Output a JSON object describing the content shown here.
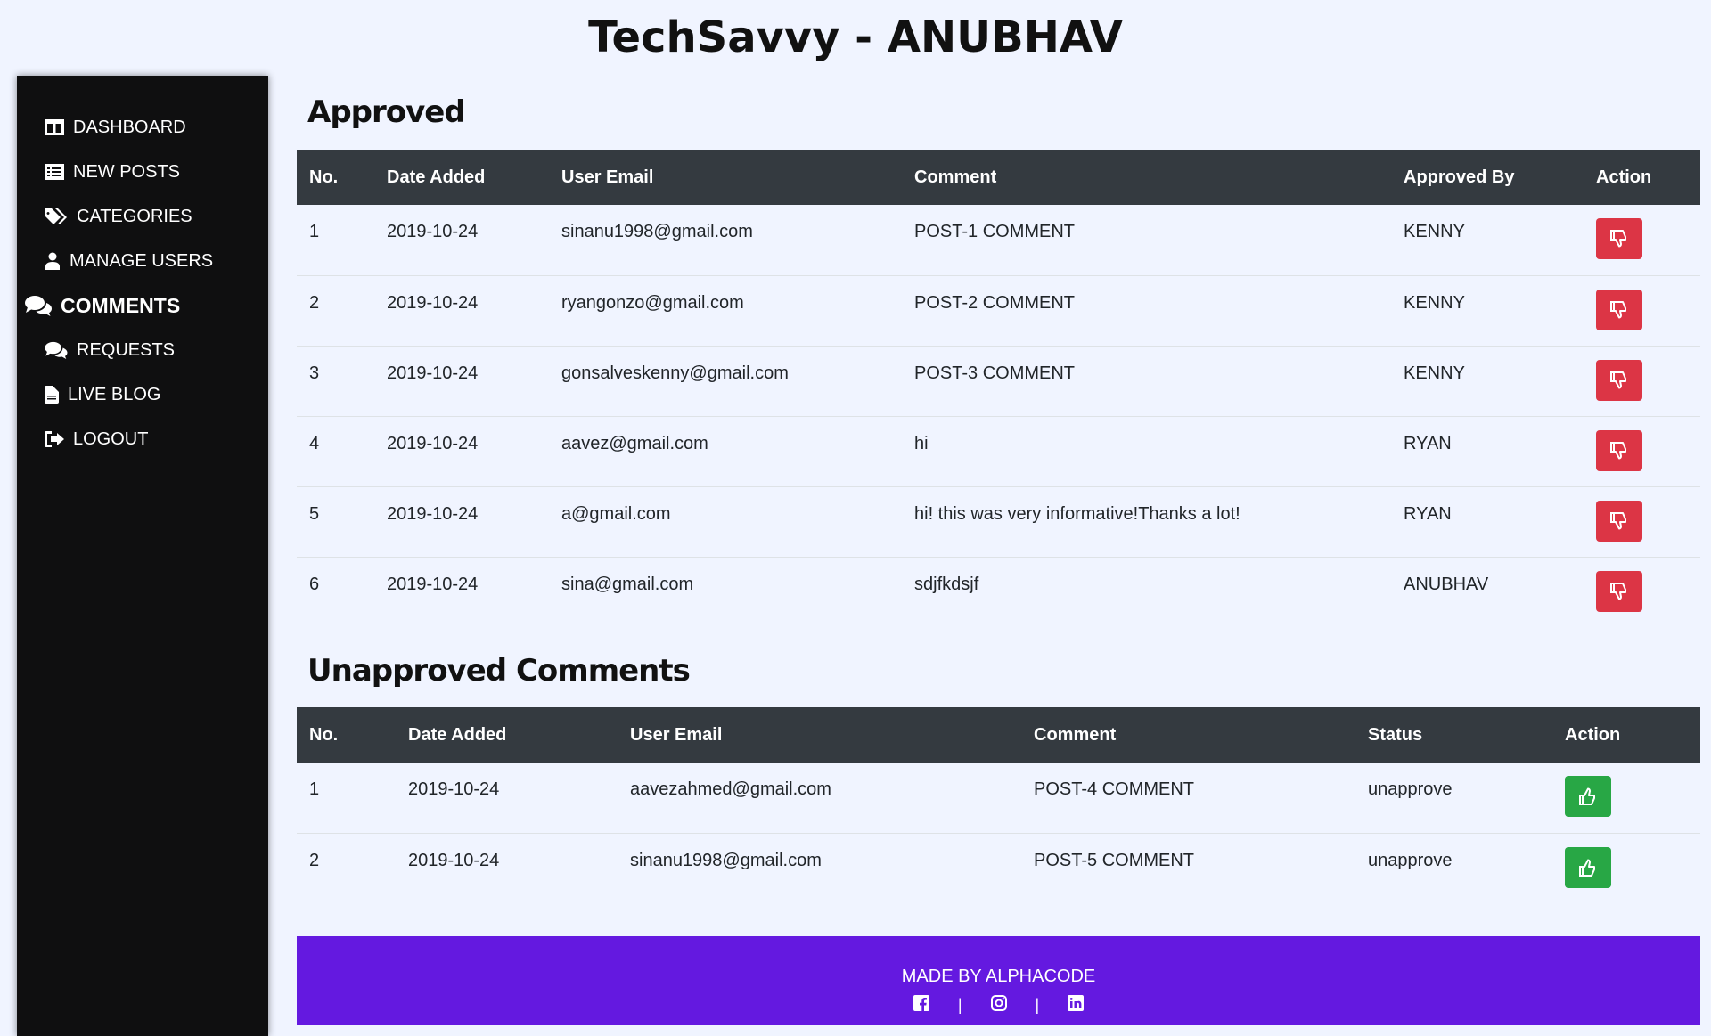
{
  "header": {
    "title": "TechSavvy - ANUBHAV"
  },
  "sidebar": {
    "items": [
      {
        "label": "DASHBOARD",
        "icon": "columns-icon"
      },
      {
        "label": "NEW POSTS",
        "icon": "list-icon"
      },
      {
        "label": "CATEGORIES",
        "icon": "tags-icon"
      },
      {
        "label": "MANAGE USERS",
        "icon": "user-icon"
      },
      {
        "label": "COMMENTS",
        "icon": "comments-icon",
        "active": true
      },
      {
        "label": "REQUESTS",
        "icon": "comments-icon"
      },
      {
        "label": "LIVE BLOG",
        "icon": "file-icon"
      },
      {
        "label": "LOGOUT",
        "icon": "sign-out-icon"
      }
    ]
  },
  "approved": {
    "title": "Approved",
    "headers": [
      "No.",
      "Date Added",
      "User Email",
      "Comment",
      "Approved By",
      "Action"
    ],
    "rows": [
      {
        "no": "1",
        "date": "2019-10-24",
        "email": "sinanu1998@gmail.com",
        "comment": "POST-1 COMMENT",
        "by": "KENNY"
      },
      {
        "no": "2",
        "date": "2019-10-24",
        "email": "ryangonzo@gmail.com",
        "comment": "POST-2 COMMENT",
        "by": "KENNY"
      },
      {
        "no": "3",
        "date": "2019-10-24",
        "email": "gonsalveskenny@gmail.com",
        "comment": "POST-3 COMMENT",
        "by": "KENNY"
      },
      {
        "no": "4",
        "date": "2019-10-24",
        "email": "aavez@gmail.com",
        "comment": "hi",
        "by": "RYAN"
      },
      {
        "no": "5",
        "date": "2019-10-24",
        "email": "a@gmail.com",
        "comment": "hi! this was very informative!Thanks a lot!",
        "by": "RYAN"
      },
      {
        "no": "6",
        "date": "2019-10-24",
        "email": "sina@gmail.com",
        "comment": "sdjfkdsjf",
        "by": "ANUBHAV"
      }
    ]
  },
  "unapproved": {
    "title": "Unapproved Comments",
    "headers": [
      "No.",
      "Date Added",
      "User Email",
      "Comment",
      "Status",
      "Action"
    ],
    "rows": [
      {
        "no": "1",
        "date": "2019-10-24",
        "email": "aavezahmed@gmail.com",
        "comment": "POST-4 COMMENT",
        "status": "unapprove"
      },
      {
        "no": "2",
        "date": "2019-10-24",
        "email": "sinanu1998@gmail.com",
        "comment": "POST-5 COMMENT",
        "status": "unapprove"
      }
    ]
  },
  "footer": {
    "text": "MADE BY ALPHACODE",
    "separator": "|",
    "social": [
      "facebook-icon",
      "instagram-icon",
      "linkedin-icon"
    ]
  },
  "colors": {
    "background": "#f0f4ff",
    "sidebar": "#0f0f10",
    "table_header": "#343a40",
    "disapprove_button": "#dc3545",
    "approve_button": "#28a745",
    "footer": "#6419e0"
  }
}
